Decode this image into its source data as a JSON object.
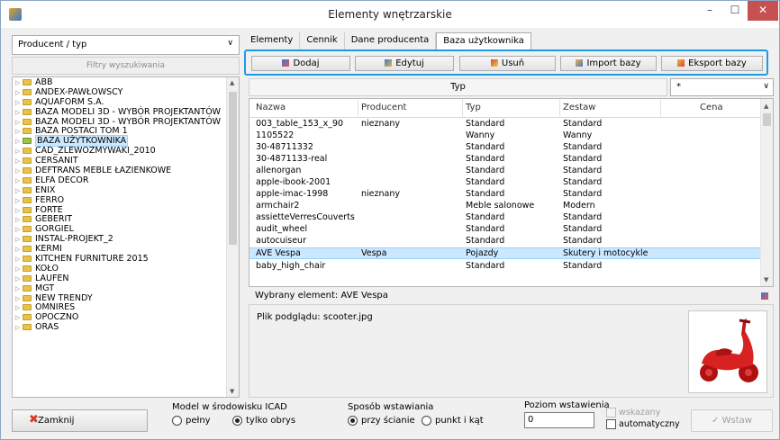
{
  "window": {
    "title": "Elementy wnętrzarskie"
  },
  "left": {
    "combo_value": "Producent / typ",
    "filter_label": "Filtry wyszukiwania",
    "tree": [
      "ABB",
      "ANDEX-PAWŁOWSCY",
      "AQUAFORM S.A.",
      "BAZA MODELI 3D - WYBÓR PROJEKTANTÓW",
      "BAZA MODELI 3D - WYBÓR PROJEKTANTÓW",
      "BAZA POSTACI TOM 1",
      "BAZA UŻYTKOWNIKA",
      "CAD_ZLEWOZMYWAKI_2010",
      "CERSANIT",
      "DEFTRANS MEBLE ŁAZIENKOWE",
      "ELFA DECOR",
      "ENIX",
      "FERRO",
      "FORTE",
      "GEBERIT",
      "GORGIEL",
      "INSTAL-PROJEKT_2",
      "KERMI",
      "KITCHEN FURNITURE 2015",
      "KOŁO",
      "LAUFEN",
      "MGT",
      "NEW TRENDY",
      "OMNIRES",
      "OPOCZNO",
      "ORAS"
    ]
  },
  "tabs": [
    "Elementy",
    "Cennik",
    "Dane producenta",
    "Baza użytkownika"
  ],
  "toolbar": {
    "add": "Dodaj",
    "edit": "Edytuj",
    "delete": "Usuń",
    "import": "Import bazy",
    "export": "Eksport bazy"
  },
  "filter": {
    "type_label": "Typ",
    "type_value": "*"
  },
  "grid": {
    "headers": [
      "Nazwa",
      "Producent",
      "Typ",
      "Zestaw",
      "Cena"
    ],
    "rows": [
      [
        "003_table_153_x_90",
        "nieznany",
        "Standard",
        "Standard",
        ""
      ],
      [
        "1105522",
        "",
        "Wanny",
        "Wanny",
        ""
      ],
      [
        "30-48711332",
        "",
        "Standard",
        "Standard",
        ""
      ],
      [
        "30-4871133-real",
        "",
        "Standard",
        "Standard",
        ""
      ],
      [
        "allenorgan",
        "",
        "Standard",
        "Standard",
        ""
      ],
      [
        "apple-ibook-2001",
        "",
        "Standard",
        "Standard",
        ""
      ],
      [
        "apple-imac-1998",
        "nieznany",
        "Standard",
        "Standard",
        ""
      ],
      [
        "armchair2",
        "",
        "Meble salonowe",
        "Modern",
        ""
      ],
      [
        "assietteVerresCouverts",
        "",
        "Standard",
        "Standard",
        ""
      ],
      [
        "audit_wheel",
        "",
        "Standard",
        "Standard",
        ""
      ],
      [
        "autocuiseur",
        "",
        "Standard",
        "Standard",
        ""
      ],
      [
        "AVE Vespa",
        "Vespa",
        "Pojazdy",
        "Skutery i motocykle",
        ""
      ],
      [
        "baby_high_chair",
        "",
        "Standard",
        "Standard",
        ""
      ]
    ],
    "selected_index": 11
  },
  "status": {
    "selected_text": "Wybrany element: AVE Vespa"
  },
  "preview": {
    "file_text": "Plik podglądu: scooter.jpg"
  },
  "bottom": {
    "close": "Zamknij",
    "model_title": "Model w środowisku ICAD",
    "model_full": "pełny",
    "model_outline": "tylko obrys",
    "insert_title": "Sposób wstawiania",
    "insert_wall": "przy ścianie",
    "insert_point": "punkt i kąt",
    "level_title": "Poziom wstawienia",
    "level_value": "0",
    "chk_indicated": "wskazany",
    "chk_auto": "automatyczny",
    "insert_btn": "Wstaw"
  },
  "colors": {
    "highlight_border": "#1d9be3",
    "selection": "#cce8ff",
    "close_red": "#c75050"
  }
}
